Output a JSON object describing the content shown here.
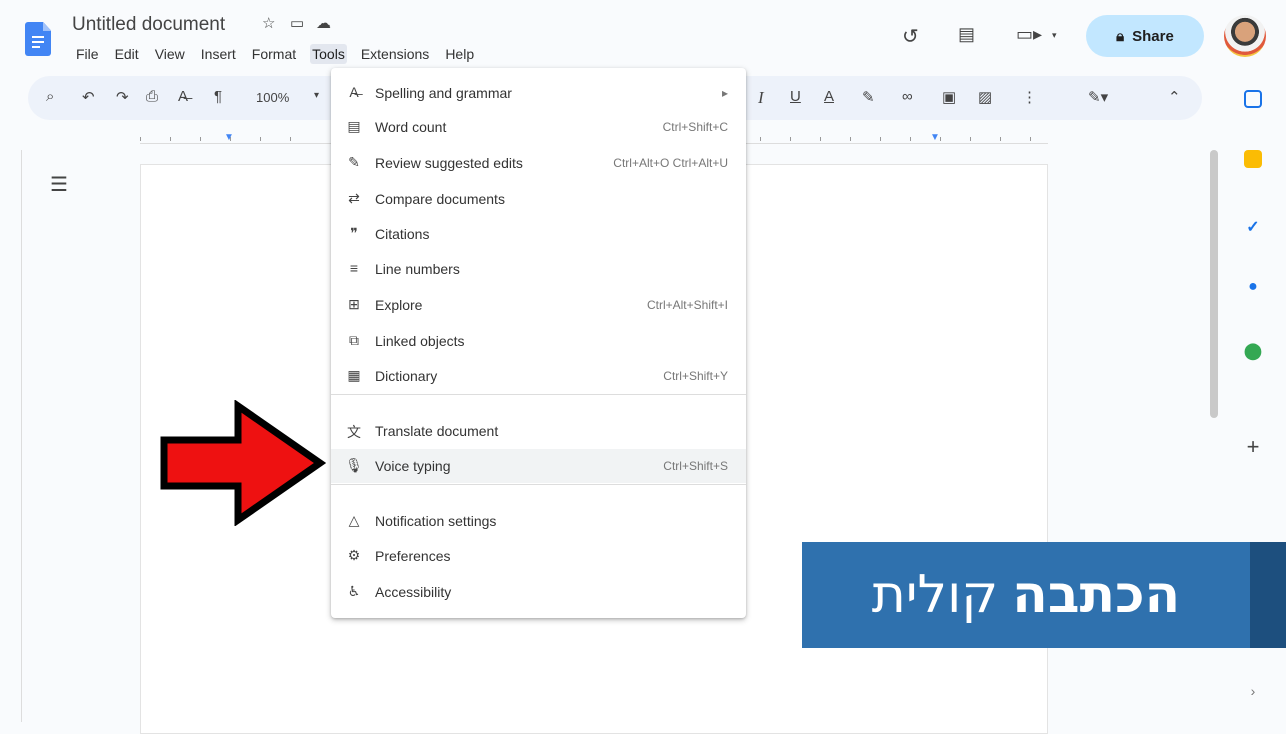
{
  "app": {
    "doc_title": "Untitled document",
    "share_label": "Share",
    "zoom": "100%"
  },
  "menubar": [
    "File",
    "Edit",
    "View",
    "Insert",
    "Format",
    "Tools",
    "Extensions",
    "Help"
  ],
  "tools_menu": {
    "items": [
      {
        "label": "Spelling and grammar",
        "shortcut": "▸",
        "icon": "spellcheck-icon"
      },
      {
        "label": "Word count",
        "shortcut": "Ctrl+Shift+C",
        "icon": "word-count-icon"
      },
      {
        "label": "Review suggested edits",
        "shortcut": "Ctrl+Alt+O Ctrl+Alt+U",
        "icon": "review-edits-icon"
      },
      {
        "label": "Compare documents",
        "shortcut": "",
        "icon": "compare-icon"
      },
      {
        "label": "Citations",
        "shortcut": "",
        "icon": "quote-icon"
      },
      {
        "label": "Line numbers",
        "shortcut": "",
        "icon": "line-numbers-icon"
      },
      {
        "label": "Explore",
        "shortcut": "Ctrl+Alt+Shift+I",
        "icon": "explore-icon"
      },
      {
        "label": "Linked objects",
        "shortcut": "",
        "icon": "linked-objects-icon"
      },
      {
        "label": "Dictionary",
        "shortcut": "Ctrl+Shift+Y",
        "icon": "dictionary-icon"
      },
      {
        "label": "Translate document",
        "shortcut": "",
        "icon": "translate-icon"
      },
      {
        "label": "Voice typing",
        "shortcut": "Ctrl+Shift+S",
        "icon": "microphone-icon"
      },
      {
        "label": "Notification settings",
        "shortcut": "",
        "icon": "bell-icon"
      },
      {
        "label": "Preferences",
        "shortcut": "",
        "icon": "preferences-icon"
      },
      {
        "label": "Accessibility",
        "shortcut": "",
        "icon": "accessibility-icon"
      }
    ]
  },
  "banner": {
    "bold_word": "הכתבה",
    "word": "קולית"
  },
  "colors": {
    "arrow": "#ee1111",
    "banner_bg": "#2f71ae",
    "share_bg": "#c2e7ff"
  }
}
